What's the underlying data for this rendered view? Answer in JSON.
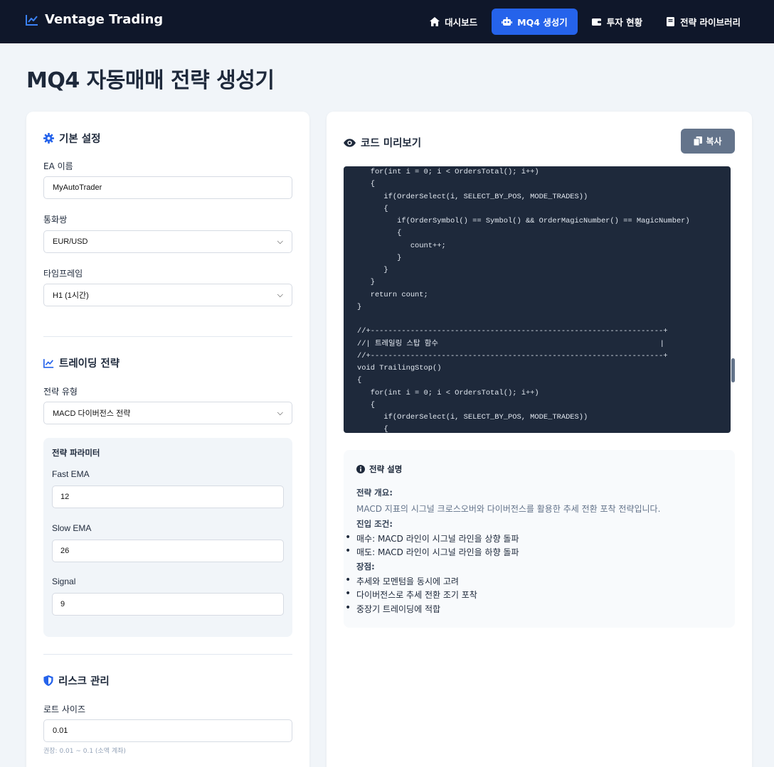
{
  "app": {
    "name": "Ventage Trading"
  },
  "nav": {
    "items": [
      {
        "label": "대시보드",
        "icon": "home-icon"
      },
      {
        "label": "MQ4 생성기",
        "icon": "robot-icon",
        "active": true
      },
      {
        "label": "투자 현황",
        "icon": "wallet-icon"
      },
      {
        "label": "전략 라이브러리",
        "icon": "book-icon"
      }
    ]
  },
  "page": {
    "title": "MQ4 자동매매 전략 생성기"
  },
  "basic": {
    "title": "기본 설정",
    "ea_label": "EA 이름",
    "ea_value": "MyAutoTrader",
    "pair_label": "통화쌍",
    "pair_value": "EUR/USD",
    "tf_label": "타임프레임",
    "tf_value": "H1 (1시간)"
  },
  "strategy": {
    "title": "트레이딩 전략",
    "type_label": "전략 유형",
    "type_value": "MACD 다이버전스 전략",
    "params_title": "전략 파라미터",
    "params": [
      {
        "label": "Fast EMA",
        "value": "12"
      },
      {
        "label": "Slow EMA",
        "value": "26"
      },
      {
        "label": "Signal",
        "value": "9"
      }
    ]
  },
  "risk": {
    "title": "리스크 관리",
    "lot_label": "로트 사이즈",
    "lot_value": "0.01",
    "lot_hint": "권장: 0.01 ~ 0.1 (소액 계좌)"
  },
  "preview": {
    "title": "코드 미리보기",
    "copy_label": "복사",
    "code": "   for(int i = 0; i < OrdersTotal(); i++)\n   {\n      if(OrderSelect(i, SELECT_BY_POS, MODE_TRADES))\n      {\n         if(OrderSymbol() == Symbol() && OrderMagicNumber() == MagicNumber)\n         {\n            count++;\n         }\n      }\n   }\n   return count;\n}\n\n//+------------------------------------------------------------------+\n//| 트레일링 스탑 함수                                                  |\n//+------------------------------------------------------------------+\nvoid TrailingStop()\n{\n   for(int i = 0; i < OrdersTotal(); i++)\n   {\n      if(OrderSelect(i, SELECT_BY_POS, MODE_TRADES))\n      {"
  },
  "description": {
    "title": "전략 설명",
    "overview_heading": "전략 개요:",
    "overview_text": "MACD 지표의 시그널 크로스오버와 다이버전스를 활용한 추세 전환 포착 전략입니다.",
    "entry_heading": "진입 조건:",
    "entry_items": [
      "매수: MACD 라인이 시그널 라인을 상향 돌파",
      "매도: MACD 라인이 시그널 라인을 하향 돌파"
    ],
    "pros_heading": "장점:",
    "pros_items": [
      "추세와 모멘텀을 동시에 고려",
      "다이버전스로 추세 전환 조기 포착",
      "중장기 트레이딩에 적합"
    ]
  },
  "colors": {
    "navbar": "#0f172a",
    "accent": "#2563eb",
    "copy_button": "#64748b",
    "code_bg": "#1e293b"
  }
}
